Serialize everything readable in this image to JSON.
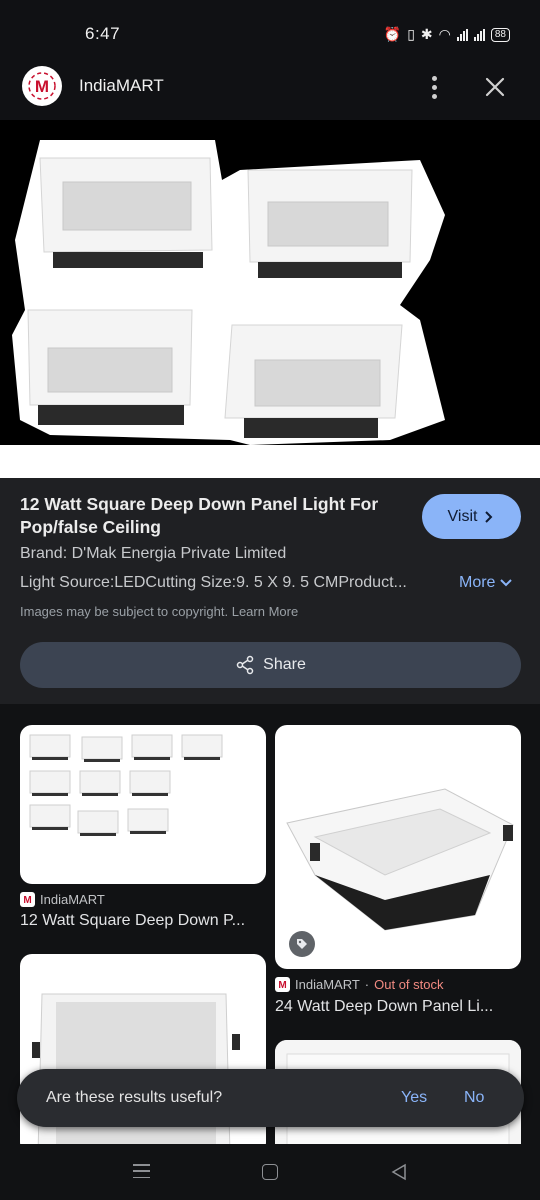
{
  "status_bar": {
    "time": "6:47",
    "battery": "88"
  },
  "header": {
    "site_name": "IndiaMART",
    "logo_letter": "M"
  },
  "product": {
    "title": "12 Watt Square Deep Down Panel Light For Pop/false Ceiling",
    "visit_label": "Visit",
    "brand": "Brand: D'Mak Energia Private Limited",
    "light_source": "Light Source:LEDCutting Size:9. 5 X 9. 5 CMProduct...",
    "more_label": "More",
    "copyright": "Images may be subject to copyright.  Learn More",
    "share_label": "Share"
  },
  "results": [
    {
      "source": "IndiaMART",
      "status": "",
      "title": "12 Watt Square Deep Down P..."
    },
    {
      "source": "IndiaMART",
      "status": "Out of stock",
      "status_sep": " · ",
      "title": "24 Watt Deep Down Panel Li..."
    }
  ],
  "feedback": {
    "question": "Are these results useful?",
    "yes": "Yes",
    "no": "No"
  },
  "colors": {
    "accent": "#8ab4f8",
    "out_of_stock": "#f28b82",
    "brand_red": "#c8102e"
  }
}
